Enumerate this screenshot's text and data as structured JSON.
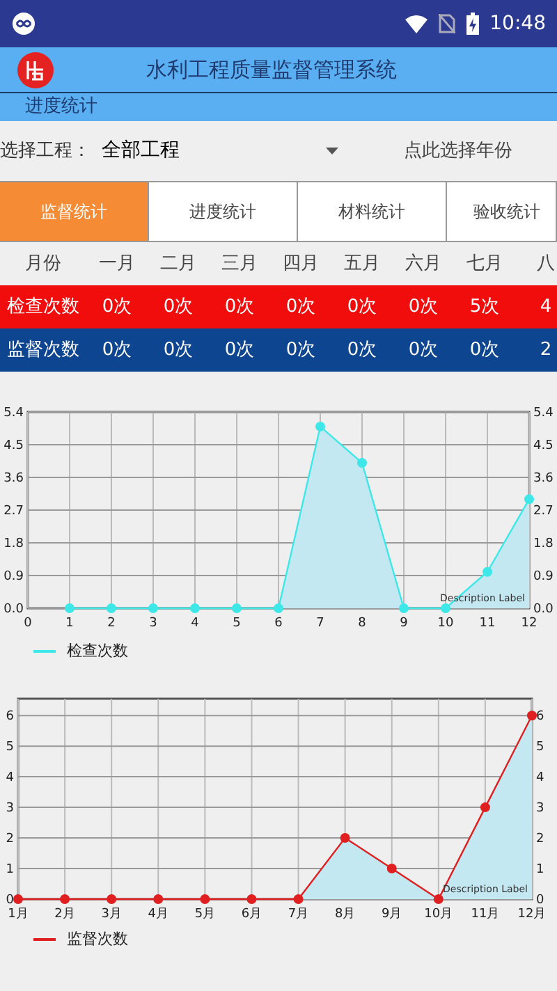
{
  "status_bar": {
    "time": "10:48"
  },
  "app_bar": {
    "title": "水利工程质量监督管理系统"
  },
  "subtitle": "进度统计",
  "selector": {
    "label": "选择工程：",
    "value": "全部工程",
    "year_button": "点此选择年份"
  },
  "tabs": [
    {
      "label": "监督统计",
      "selected": true
    },
    {
      "label": "进度统计",
      "selected": false
    },
    {
      "label": "材料统计",
      "selected": false
    },
    {
      "label": "验收统计",
      "selected": false
    }
  ],
  "table": {
    "header": [
      "月份",
      "一月",
      "二月",
      "三月",
      "四月",
      "五月",
      "六月",
      "七月",
      "八"
    ],
    "rows": [
      {
        "color": "#f20d0d",
        "cells": [
          "检查次数",
          "0次",
          "0次",
          "0次",
          "0次",
          "0次",
          "0次",
          "5次",
          "4"
        ]
      },
      {
        "color": "#0d4590",
        "cells": [
          "监督次数",
          "0次",
          "0次",
          "0次",
          "0次",
          "0次",
          "0次",
          "0次",
          "2"
        ]
      }
    ]
  },
  "charts": [
    {
      "description": "Description Label",
      "right_axis_labels": [
        "5.4",
        "4.5",
        "3.6",
        "2.7",
        "1.8",
        "0.9",
        "0.0"
      ],
      "chart_data": {
        "type": "area",
        "grid": true,
        "x": [
          1,
          2,
          3,
          4,
          5,
          6,
          7,
          8,
          9,
          10,
          11,
          12
        ],
        "series": [
          {
            "name": "检查次数",
            "color": "#3ee8e8",
            "values": [
              0,
              0,
              0,
              0,
              0,
              0,
              5,
              4,
              0,
              0,
              1,
              3
            ]
          }
        ],
        "xlim": [
          0,
          12
        ],
        "ylim": [
          0,
          5.4
        ],
        "xticks": [
          0,
          1,
          2,
          3,
          4,
          5,
          6,
          7,
          8,
          9,
          10,
          11,
          12
        ],
        "yticks": [
          {
            "value": 0,
            "label": "0.0"
          },
          {
            "value": 0.9,
            "label": "0.9"
          },
          {
            "value": 1.8,
            "label": "1.8"
          },
          {
            "value": 2.7,
            "label": "2.7"
          },
          {
            "value": 3.6,
            "label": "3.6"
          },
          {
            "value": 4.5,
            "label": "4.5"
          },
          {
            "value": 5.4,
            "label": "5.4"
          }
        ]
      }
    },
    {
      "description": "Description Label",
      "right_axis_labels": [
        "6",
        "5",
        "4",
        "3",
        "2",
        "1",
        "0"
      ],
      "chart_data": {
        "type": "area",
        "grid": true,
        "x": [
          1,
          2,
          3,
          4,
          5,
          6,
          7,
          8,
          9,
          10,
          11,
          12
        ],
        "series": [
          {
            "name": "监督次数",
            "color": "#e02020",
            "values": [
              0,
              0,
              0,
              0,
              0,
              0,
              0,
              2,
              1,
              0,
              3,
              6
            ]
          }
        ],
        "xlim": [
          1,
          12
        ],
        "ylim": [
          0,
          6.55
        ],
        "xticks": [
          {
            "value": 1,
            "label": "1月"
          },
          {
            "value": 2,
            "label": "2月"
          },
          {
            "value": 3,
            "label": "3月"
          },
          {
            "value": 4,
            "label": "4月"
          },
          {
            "value": 5,
            "label": "5月"
          },
          {
            "value": 6,
            "label": "6月"
          },
          {
            "value": 7,
            "label": "7月"
          },
          {
            "value": 8,
            "label": "8月"
          },
          {
            "value": 9,
            "label": "9月"
          },
          {
            "value": 10,
            "label": "10月"
          },
          {
            "value": 11,
            "label": "11月"
          },
          {
            "value": 12,
            "label": "12月"
          }
        ],
        "yticks": [
          0,
          1,
          2,
          3,
          4,
          5,
          6
        ]
      }
    }
  ]
}
